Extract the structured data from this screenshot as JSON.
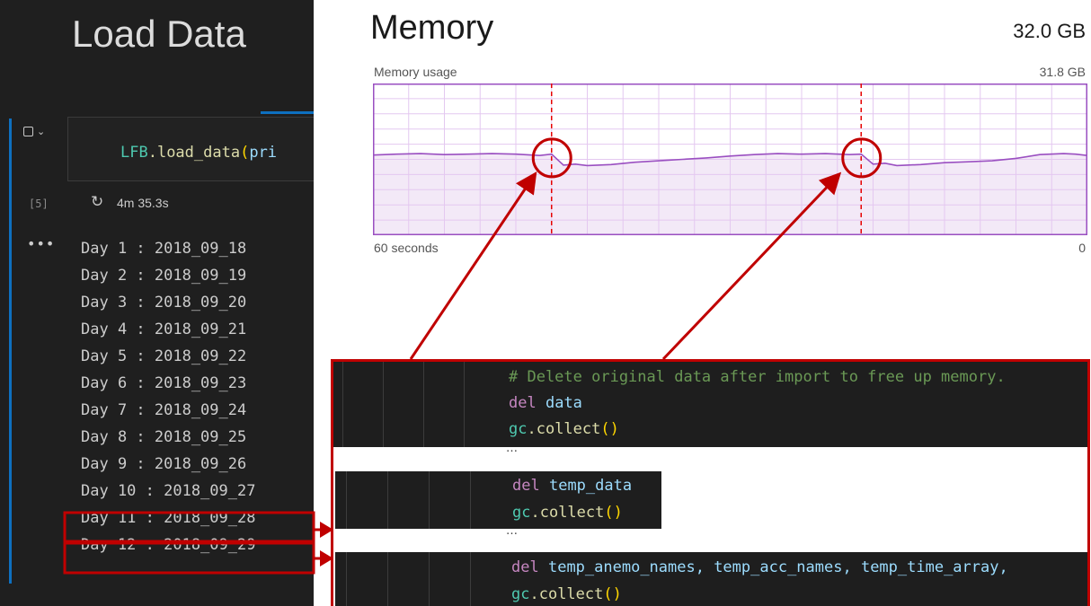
{
  "notebook": {
    "title": "Load Data",
    "cell": {
      "code_object": "LFB",
      "code_method": ".load_data",
      "code_paren": "(",
      "code_arg": "pri",
      "exec_count": "[5]",
      "exec_time": "4m 35.3s"
    },
    "output_lines": [
      "Day 1 : 2018_09_18",
      "Day 2 : 2018_09_19",
      "Day 3 : 2018_09_20",
      "Day 4 : 2018_09_21",
      "Day 5 : 2018_09_22",
      "Day 6 : 2018_09_23",
      "Day 7 : 2018_09_24",
      "Day 8 : 2018_09_25",
      "Day 9 : 2018_09_26",
      "Day 10 : 2018_09_27",
      "Day 11 : 2018_09_28",
      "Day 12 : 2018_09_29"
    ],
    "icons": {
      "toggle": "checkbox-icon",
      "expand": "chevron-down-icon",
      "refresh": "refresh-icon",
      "more": "ellipsis-icon"
    }
  },
  "memory": {
    "title": "Memory",
    "total": "32.0 GB",
    "usage_label": "Memory usage",
    "max_label": "31.8 GB",
    "x_left_label": "60 seconds",
    "x_right_label": "0",
    "line_color": "#9a4fc1",
    "fill_color": "#f3e9f7",
    "grid_color": "#e4c8f0"
  },
  "chart_data": {
    "type": "area",
    "title": "Memory usage",
    "xlabel": "60 seconds",
    "x_range": [
      60,
      0
    ],
    "ylim": [
      0,
      31.8
    ],
    "grid": true,
    "x": [
      60,
      58,
      56,
      54,
      52,
      50,
      48,
      46,
      45,
      44,
      43,
      42,
      40,
      38,
      36,
      34,
      32,
      30,
      28,
      26,
      24,
      22,
      20,
      19,
      18,
      17,
      16,
      14,
      12,
      10,
      8,
      6,
      4,
      2,
      1,
      0
    ],
    "values": [
      16.8,
      17.0,
      17.1,
      16.9,
      17.0,
      17.1,
      17.0,
      16.7,
      17.0,
      14.7,
      14.9,
      14.6,
      14.8,
      15.3,
      15.6,
      15.9,
      16.2,
      16.6,
      16.9,
      17.1,
      17.0,
      17.1,
      16.9,
      17.0,
      14.9,
      15.1,
      14.6,
      14.8,
      15.2,
      15.4,
      15.6,
      16.1,
      16.9,
      17.1,
      17.0,
      16.7
    ],
    "annotations": [
      {
        "x": 45,
        "label": "",
        "style": "red dashed line with circle"
      },
      {
        "x": 19,
        "label": "",
        "style": "red dashed line with circle"
      }
    ]
  },
  "snippets": {
    "block1": [
      "# Delete original data after import to free up memory.",
      "del",
      "data",
      "gc",
      ".collect",
      "()"
    ],
    "block2": [
      "del",
      "temp_data",
      "gc",
      ".collect",
      "()"
    ],
    "block3": [
      "del",
      "temp_anemo_names, temp_acc_names, temp_time_array,",
      "gc",
      ".collect",
      "()"
    ],
    "ellipsis": "…"
  },
  "colors": {
    "highlight": "#c00000",
    "dark_bg": "#1f1f1f",
    "accent": "#0e70c0"
  }
}
